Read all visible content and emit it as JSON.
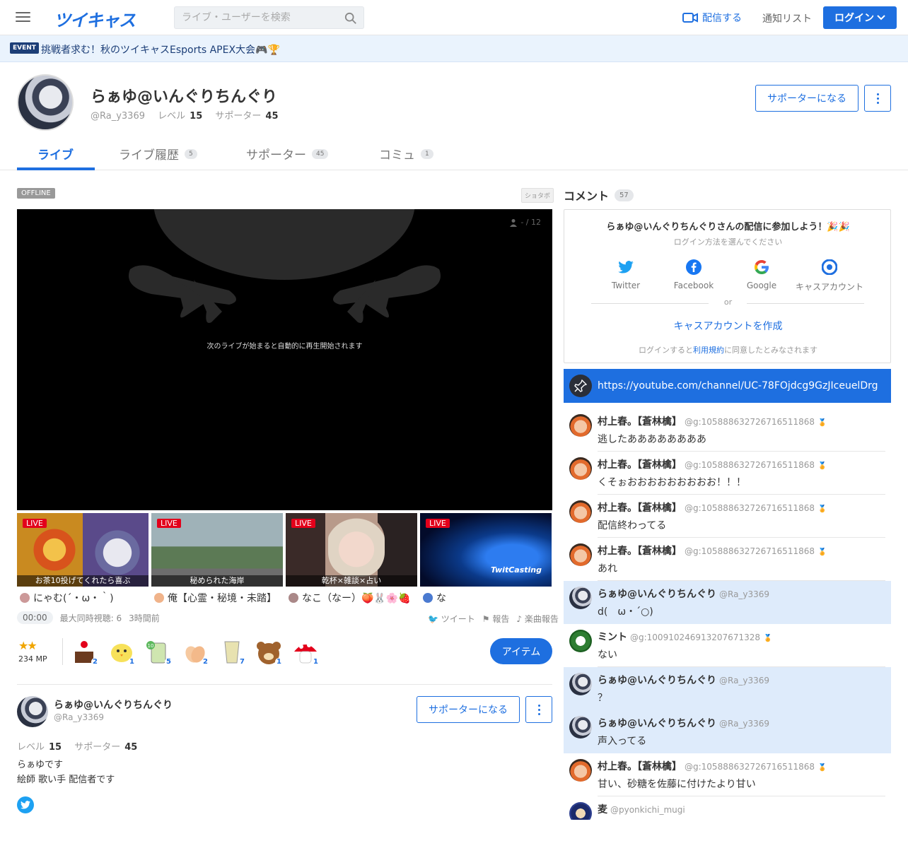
{
  "header": {
    "logo": "ツイキャス",
    "search_placeholder": "ライブ・ユーザーを検索",
    "broadcast": "配信する",
    "notify": "通知リスト",
    "login": "ログイン"
  },
  "event": {
    "badge": "EVENT",
    "text": "挑戦者求む！秋のツイキャスEsports APEX大会🎮🏆"
  },
  "profile": {
    "name": "らぁゆ@いんぐりちんぐり",
    "id": "@Ra_y3369",
    "level_label": "レベル",
    "level": "15",
    "supporter_label": "サポーター",
    "supporters": "45",
    "support_button": "サポーターになる"
  },
  "tabs": [
    {
      "label": "ライブ",
      "count": ""
    },
    {
      "label": "ライブ履歴",
      "count": "5"
    },
    {
      "label": "サポーター",
      "count": "45"
    },
    {
      "label": "コミュ",
      "count": "1"
    }
  ],
  "player": {
    "status": "OFFLINE",
    "shotabo": "ショタボ",
    "viewers": "- / 12",
    "message": "次のライブが始まると自動的に再生開始されます"
  },
  "thumbs": [
    {
      "live": "LIVE",
      "caption": "お茶10投げてくれたら喜ぶ",
      "user": "にゃむ(´・ω・｀)"
    },
    {
      "live": "LIVE",
      "caption": "秘められた海岸",
      "user": "俺【心霊・秘境・未踏】"
    },
    {
      "live": "LIVE",
      "caption": "乾杯×雑談×占い",
      "user": "なこ（なー）🍑🐰🌸🍓"
    },
    {
      "live": "LIVE",
      "caption": "",
      "user": "な"
    }
  ],
  "stats": {
    "time": "00:00",
    "max_viewers": "最大同時視聴: 6",
    "duration": "3時間前",
    "tweet": "ツイート",
    "report": "報告",
    "song_report": "楽曲報告"
  },
  "items": {
    "stars": "★★",
    "mp": "234 MP",
    "gifts": [
      {
        "name": "cake-icon",
        "count": "2"
      },
      {
        "name": "chick-icon",
        "count": "1"
      },
      {
        "name": "tea-icon",
        "count": "5"
      },
      {
        "name": "clap-icon",
        "count": "2"
      },
      {
        "name": "cup-icon",
        "count": "7"
      },
      {
        "name": "bear-icon",
        "count": "1"
      },
      {
        "name": "mushroom-icon",
        "count": "1"
      }
    ],
    "button": "アイテム"
  },
  "profile_card": {
    "name": "らぁゆ@いんぐりちんぐり",
    "id": "@Ra_y3369",
    "support_button": "サポーターになる",
    "level_label": "レベル",
    "level": "15",
    "supporter_label": "サポーター",
    "supporters": "45",
    "bio_line1": "らぁゆです",
    "bio_line2": "絵師 歌い手 配信者です"
  },
  "comments_panel": {
    "title": "コメント",
    "count": "57",
    "login_title": "らぁゆ@いんぐりちんぐりさんの配信に参加しよう！🎉🎉",
    "login_sub": "ログイン方法を選んでください",
    "options": [
      "Twitter",
      "Facebook",
      "Google",
      "キャスアカウント"
    ],
    "or": "or",
    "create": "キャスアカウントを作成",
    "terms_prefix": "ログインすると",
    "terms_link": "利用規約",
    "terms_suffix": "に同意したとみなされます",
    "pinned": "https://youtube.com/channel/UC-78FOjdcg9GzJIceuelDrg"
  },
  "comments": [
    {
      "name": "村上春。【蒼林檎】",
      "id": "@g:105888632726716511868",
      "text": "逃したああああああああ",
      "hl": false,
      "ava": "m",
      "medal": true
    },
    {
      "name": "村上春。【蒼林檎】",
      "id": "@g:105888632726716511868",
      "text": "くそぉおおおおおおおおお！！！",
      "hl": false,
      "ava": "m",
      "medal": true
    },
    {
      "name": "村上春。【蒼林檎】",
      "id": "@g:105888632726716511868",
      "text": "配信終わってる",
      "hl": false,
      "ava": "m",
      "medal": true
    },
    {
      "name": "村上春。【蒼林檎】",
      "id": "@g:105888632726716511868",
      "text": "あれ",
      "hl": false,
      "ava": "m",
      "medal": true
    },
    {
      "name": "らぁゆ@いんぐりちんぐり",
      "id": "@Ra_y3369",
      "text": "d(　ω・´○)",
      "hl": true,
      "ava": "r",
      "medal": false
    },
    {
      "name": "ミント",
      "id": "@g:100910246913207671328",
      "text": "ない",
      "hl": false,
      "ava": "g",
      "medal": true
    },
    {
      "name": "らぁゆ@いんぐりちんぐり",
      "id": "@Ra_y3369",
      "text": "？",
      "hl": true,
      "ava": "r",
      "medal": false
    },
    {
      "name": "らぁゆ@いんぐりちんぐり",
      "id": "@Ra_y3369",
      "text": "声入ってる",
      "hl": true,
      "ava": "r",
      "medal": false
    },
    {
      "name": "村上春。【蒼林檎】",
      "id": "@g:105888632726716511868",
      "text": "甘い、砂糖を佐藤に付けたより甘い",
      "hl": false,
      "ava": "m",
      "medal": true
    },
    {
      "name": "麦",
      "id": "@pyonkichi_mugi",
      "text": "",
      "hl": false,
      "ava": "b",
      "medal": false
    }
  ]
}
